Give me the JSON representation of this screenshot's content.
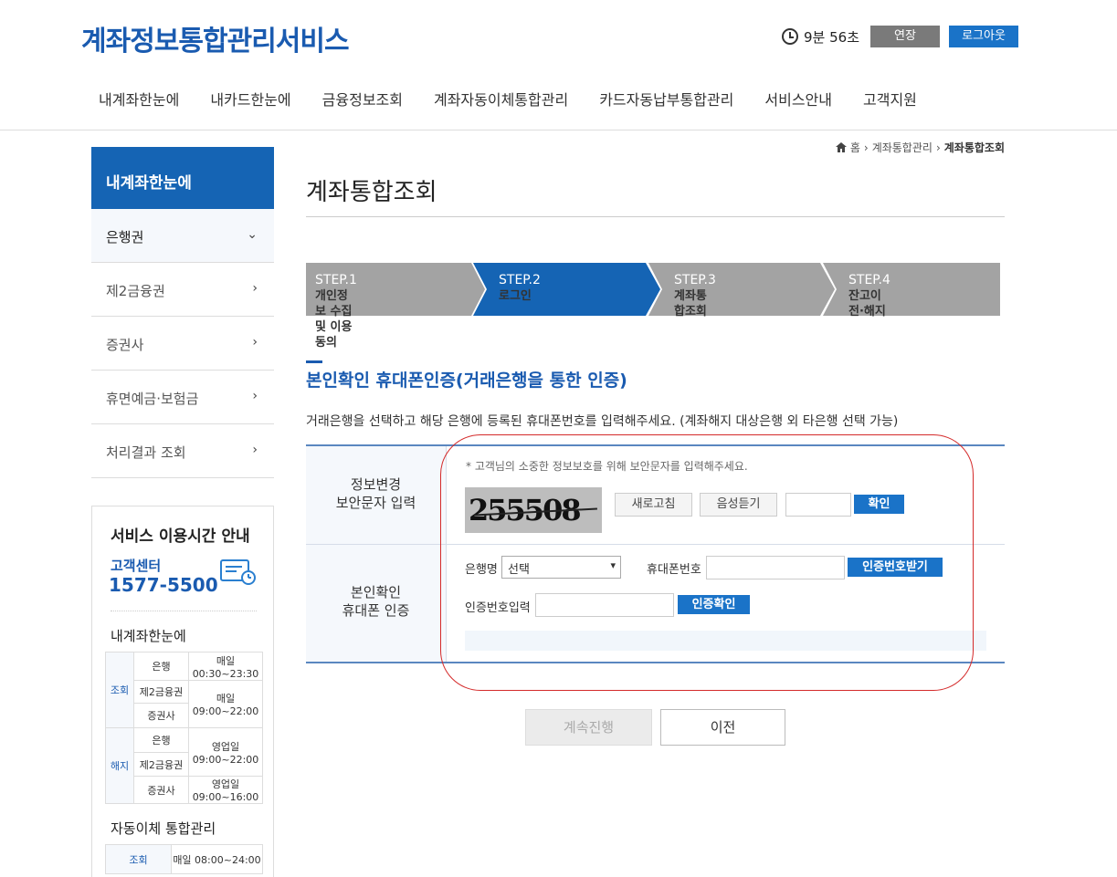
{
  "header": {
    "logo": "계좌정보통합관리서비스",
    "timer": "9분 56초",
    "extend_label": "연장",
    "logout_label": "로그아웃"
  },
  "gnb": [
    "내계좌한눈에",
    "내카드한눈에",
    "금융정보조회",
    "계좌자동이체통합관리",
    "카드자동납부통합관리",
    "서비스안내",
    "고객지원"
  ],
  "sidebar": {
    "title": "내계좌한눈에",
    "items": [
      {
        "label": "은행권",
        "chevron": "v"
      },
      {
        "label": "제2금융권",
        "chevron": ">"
      },
      {
        "label": "증권사",
        "chevron": ">"
      },
      {
        "label": "휴면예금·보험금",
        "chevron": ">"
      },
      {
        "label": "처리결과 조회",
        "chevron": ">"
      }
    ]
  },
  "service_info": {
    "title": "서비스 이용시간 안내",
    "cc_label": "고객센터",
    "cc_number": "1577-5500",
    "section1": "내계좌한눈에",
    "rows1": {
      "cat_view": "조회",
      "cat_cancel": "해지",
      "bank": "은행",
      "second": "제2금융권",
      "sec": "증권사",
      "t1a": "매일",
      "t1b": "00:30~23:30",
      "t2a": "매일",
      "t2b": "09:00~22:00",
      "t3a": "영업일",
      "t3b": "09:00~22:00",
      "t4a": "영업일",
      "t4b": "09:00~16:00"
    },
    "section2": "자동이체 통합관리",
    "rows2": {
      "cat": "조회",
      "time": "매일 08:00~24:00"
    }
  },
  "breadcrumb": {
    "home": "홈",
    "mid": "계좌통합관리",
    "current": "계좌통합조회"
  },
  "page_title": "계좌통합조회",
  "steps": [
    {
      "num": "STEP.1",
      "label": "개인정보 수집 및 이용동의"
    },
    {
      "num": "STEP.2",
      "label": "로그인"
    },
    {
      "num": "STEP.3",
      "label": "계좌통합조회"
    },
    {
      "num": "STEP.4",
      "label": "잔고이전·해지"
    }
  ],
  "section": {
    "title": "본인확인 휴대폰인증(거래은행을 통한 인증)",
    "desc": "거래은행을 선택하고 해당 은행에 등록된 휴대폰번호를 입력해주세요. (계좌해지 대상은행 외 타은행 선택 가능)"
  },
  "form": {
    "th1a": "정보변경",
    "th1b": "보안문자 입력",
    "note": "* 고객님의 소중한 정보보호를 위해 보안문자를 입력해주세요.",
    "captcha": "255508",
    "refresh_label": "새로고침",
    "audio_label": "음성듣기",
    "confirm_label": "확인",
    "th2a": "본인확인",
    "th2b": "휴대폰 인증",
    "bank_label": "은행명",
    "bank_selected": "선택",
    "phone_label": "휴대폰번호",
    "send_code_label": "인증번호받기",
    "code_label": "인증번호입력",
    "verify_label": "인증확인"
  },
  "actions": {
    "next": "계속진행",
    "prev": "이전"
  }
}
